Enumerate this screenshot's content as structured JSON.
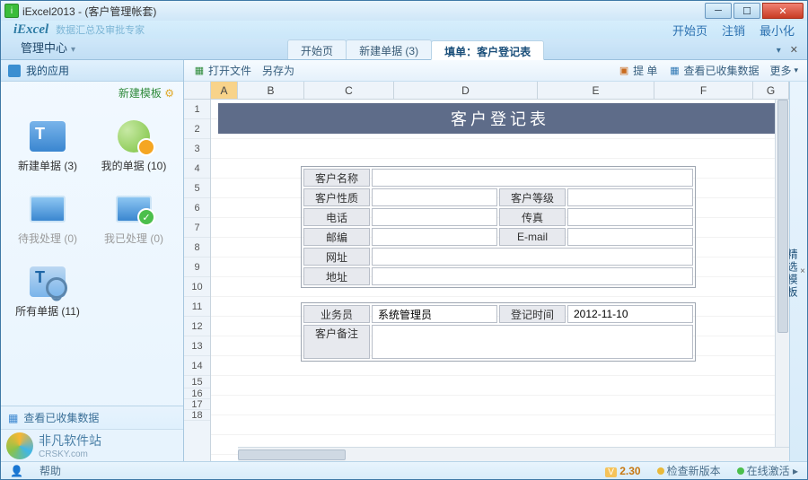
{
  "window": {
    "title": "iExcel2013 - (客户管理帐套)"
  },
  "brand": {
    "logo": "iExcel",
    "tagline": "数据汇总及审批专家"
  },
  "topLinks": {
    "home": "开始页",
    "logout": "注销",
    "minimize": "最小化"
  },
  "mgmtCenter": "管理中心",
  "tabs": {
    "t1": "开始页",
    "t2": "新建单据 (3)",
    "t3": "填单：客户登记表"
  },
  "sidebar": {
    "heading": "我的应用",
    "newTemplate": "新建模板",
    "tiles": {
      "newDoc": "新建单据 (3)",
      "myDocs": "我的单据 (10)",
      "toHandle": "待我处理 (0)",
      "handled": "我已处理 (0)",
      "allDocs": "所有单据  (11)"
    },
    "footLink": "查看已收集数据",
    "watermark": "非凡软件站",
    "watermarkSub": "CRSKY.com"
  },
  "toolbar": {
    "openFile": "打开文件",
    "saveAs": "另存为",
    "submit": "提 单",
    "viewCollected": "查看已收集数据",
    "more": "更多"
  },
  "rightRail": "精选模板",
  "columns": {
    "A": "A",
    "B": "B",
    "C": "C",
    "D": "D",
    "E": "E",
    "F": "F",
    "G": "G"
  },
  "formTitle": "客户登记表",
  "form": {
    "custName": "客户名称",
    "custNature": "客户性质",
    "custLevel": "客户等级",
    "phone": "电话",
    "fax": "传真",
    "zip": "邮编",
    "email": "E-mail",
    "url": "网址",
    "addr": "地址",
    "agent": "业务员",
    "agentVal": "系统管理员",
    "regTime": "登记时间",
    "regTimeVal": "2012-11-10",
    "remark": "客户备注"
  },
  "status": {
    "help": "帮助",
    "version": "2.30",
    "checkNew": "检查新版本",
    "onlineActivate": "在线激活"
  }
}
